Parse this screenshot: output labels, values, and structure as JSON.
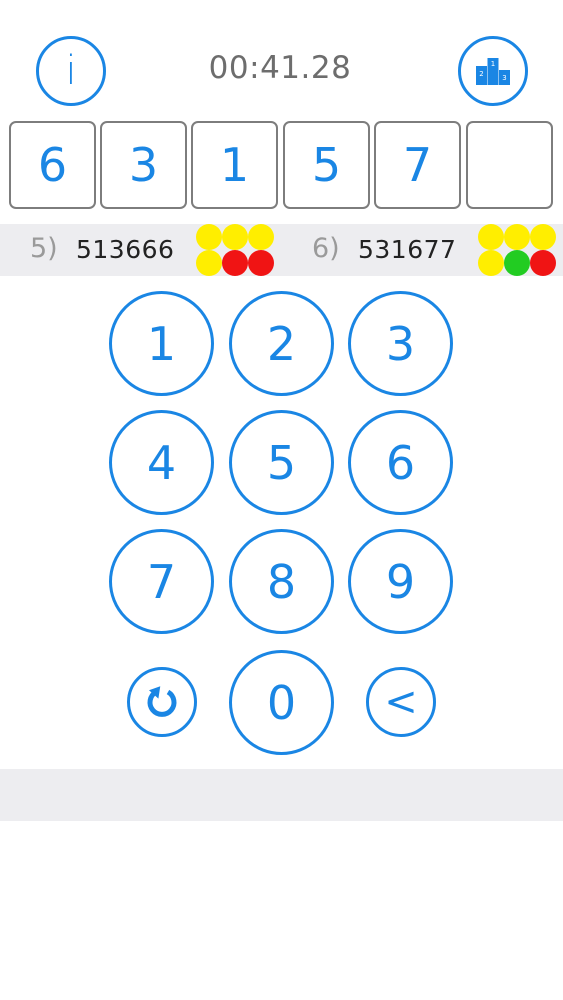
{
  "header": {
    "info_label": "i",
    "timer": "00:41.28",
    "leaderboard_icon": "podium-icon"
  },
  "current_guess": [
    "6",
    "3",
    "1",
    "5",
    "7",
    ""
  ],
  "history": [
    {
      "index": "5)",
      "code": "513666",
      "pegs": [
        "yellow",
        "yellow",
        "yellow",
        "yellow",
        "red",
        "red"
      ]
    },
    {
      "index": "6)",
      "code": "531677",
      "pegs": [
        "yellow",
        "yellow",
        "yellow",
        "yellow",
        "green",
        "red"
      ]
    }
  ],
  "keypad": {
    "digits": [
      "1",
      "2",
      "3",
      "4",
      "5",
      "6",
      "7",
      "8",
      "9"
    ],
    "zero": "0",
    "reset_icon": "refresh-icon",
    "backspace_label": "<"
  },
  "colors": {
    "accent": "#1a86e4",
    "peg_yellow": "#ffee00",
    "peg_red": "#f01414",
    "peg_green": "#22cc22",
    "strip_bg": "#ededf0"
  }
}
